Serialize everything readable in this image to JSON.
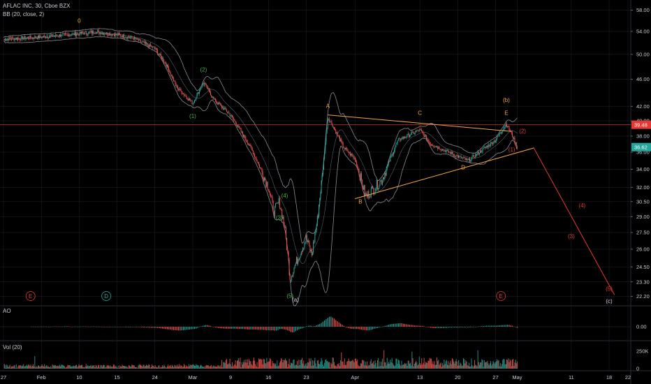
{
  "header": {
    "symbol_line": "AFLAC INC, 30, Cboe BZX",
    "indicator_line": "BB (20, close, 2)"
  },
  "panes": {
    "ao_label": "AO",
    "volume_label": "Vol (20)"
  },
  "colors": {
    "background": "#000000",
    "grid": "#1c1e24",
    "candle_up": "#26a69a",
    "candle_down": "#ef5350",
    "bollinger": "#8a8d95",
    "trendline": "#f7a54a",
    "projection": "#e53935",
    "price_line": "#c0392b",
    "wave_orange": "#f7a54a",
    "wave_green": "#4caf50",
    "wave_red": "#e53935"
  },
  "chart_data": {
    "type": "candlestick",
    "price_axis": {
      "ticks": [
        "58.00",
        "54.00",
        "50.00",
        "46.00",
        "42.00",
        "40.00",
        "38.00",
        "36.00",
        "34.00",
        "32.00",
        "30.50",
        "29.00",
        "27.50",
        "26.00",
        "24.50",
        "23.30",
        "22.20"
      ],
      "ylim": [
        21.5,
        60
      ],
      "scale": "log"
    },
    "time_axis": {
      "ticks": [
        "27",
        "Feb",
        "10",
        "15",
        "24",
        "Mar",
        "9",
        "16",
        "23",
        "Apr",
        "13",
        "20",
        "27",
        "May",
        "11",
        "18",
        "22"
      ]
    },
    "price_tags": [
      {
        "value": "39.48",
        "role": "horizontal-level",
        "color": "#e53935"
      },
      {
        "value": "36.62",
        "role": "last-price",
        "color": "#26a69a"
      }
    ],
    "path": [
      {
        "date": "2020-01-27",
        "price": 52.6
      },
      {
        "date": "2020-02-03",
        "price": 53.0
      },
      {
        "date": "2020-02-10",
        "price": 53.6
      },
      {
        "date": "2020-02-13",
        "price": 53.9
      },
      {
        "date": "2020-02-17",
        "price": 53.4
      },
      {
        "date": "2020-02-20",
        "price": 52.8
      },
      {
        "date": "2020-02-24",
        "price": 51.0
      },
      {
        "date": "2020-02-26",
        "price": 48.5
      },
      {
        "date": "2020-02-28",
        "price": 44.8
      },
      {
        "date": "2020-03-02",
        "price": 42.4
      },
      {
        "date": "2020-03-04",
        "price": 45.5
      },
      {
        "date": "2020-03-06",
        "price": 42.9
      },
      {
        "date": "2020-03-09",
        "price": 40.8
      },
      {
        "date": "2020-03-11",
        "price": 38.5
      },
      {
        "date": "2020-03-13",
        "price": 36.2
      },
      {
        "date": "2020-03-16",
        "price": 32.0
      },
      {
        "date": "2020-03-17",
        "price": 29.5
      },
      {
        "date": "2020-03-18",
        "price": 30.5
      },
      {
        "date": "2020-03-19",
        "price": 28.0
      },
      {
        "date": "2020-03-20",
        "price": 23.6
      },
      {
        "date": "2020-03-23",
        "price": 27.0
      },
      {
        "date": "2020-03-24",
        "price": 25.5
      },
      {
        "date": "2020-03-25",
        "price": 28.5
      },
      {
        "date": "2020-03-26",
        "price": 33.5
      },
      {
        "date": "2020-03-27",
        "price": 40.5
      },
      {
        "date": "2020-03-30",
        "price": 36.5
      },
      {
        "date": "2020-04-01",
        "price": 35.2
      },
      {
        "date": "2020-04-03",
        "price": 31.0
      },
      {
        "date": "2020-04-06",
        "price": 32.8
      },
      {
        "date": "2020-04-09",
        "price": 37.5
      },
      {
        "date": "2020-04-13",
        "price": 38.8
      },
      {
        "date": "2020-04-15",
        "price": 37.0
      },
      {
        "date": "2020-04-20",
        "price": 35.5
      },
      {
        "date": "2020-04-22",
        "price": 35.0
      },
      {
        "date": "2020-04-27",
        "price": 37.5
      },
      {
        "date": "2020-04-29",
        "price": 39.6
      },
      {
        "date": "2020-04-30",
        "price": 38.2
      },
      {
        "date": "2020-05-01",
        "price": 36.6
      }
    ],
    "projection": [
      {
        "date": "2020-05-04",
        "price": 36.6
      },
      {
        "date": "2020-05-19",
        "price": 22.3
      }
    ],
    "trendlines": [
      {
        "from": {
          "date": "2020-03-27",
          "price": 40.8
        },
        "to": {
          "date": "2020-04-30",
          "price": 38.6
        }
      },
      {
        "from": {
          "date": "2020-04-01",
          "price": 30.8
        },
        "to": {
          "date": "2020-05-04",
          "price": 36.5
        }
      }
    ],
    "horizontal_level": 39.48,
    "wave_labels": [
      {
        "text": "0",
        "date": "2020-02-10",
        "price": 55.6,
        "color": "#f7a54a"
      },
      {
        "text": "(2)",
        "date": "2020-03-04",
        "price": 47.2,
        "color": "#4caf50"
      },
      {
        "text": "(1)",
        "date": "2020-03-02",
        "price": 40.4,
        "color": "#4caf50"
      },
      {
        "text": "(4)",
        "date": "2020-03-19",
        "price": 30.9,
        "color": "#4caf50"
      },
      {
        "text": "(3)",
        "date": "2020-03-18",
        "price": 28.7,
        "color": "#4caf50"
      },
      {
        "text": "(5)",
        "date": "2020-03-20",
        "price": 22.1,
        "color": "#4caf50"
      },
      {
        "text": "(a)",
        "date": "2020-03-21",
        "price": 21.8,
        "color": "#d1d4dc"
      },
      {
        "text": "A",
        "date": "2020-03-27",
        "price": 41.8,
        "color": "#f7a54a"
      },
      {
        "text": "B",
        "date": "2020-04-02",
        "price": 30.3,
        "color": "#f7a54a"
      },
      {
        "text": "C",
        "date": "2020-04-13",
        "price": 40.8,
        "color": "#f7a54a"
      },
      {
        "text": "D",
        "date": "2020-04-21",
        "price": 34.0,
        "color": "#f7a54a"
      },
      {
        "text": "E",
        "date": "2020-04-29",
        "price": 40.8,
        "color": "#f7a54a"
      },
      {
        "text": "(b)",
        "date": "2020-04-29",
        "price": 42.6,
        "color": "#f7a54a"
      },
      {
        "text": "(2)",
        "date": "2020-05-02",
        "price": 38.4,
        "color": "#e53935"
      },
      {
        "text": "(1)",
        "date": "2020-04-30",
        "price": 36.1,
        "color": "#e53935"
      },
      {
        "text": "(4)",
        "date": "2020-05-13",
        "price": 29.9,
        "color": "#e53935"
      },
      {
        "text": "(3)",
        "date": "2020-05-11",
        "price": 27.0,
        "color": "#e53935"
      },
      {
        "text": "(5)",
        "date": "2020-05-18",
        "price": 22.6,
        "color": "#e53935"
      },
      {
        "text": "(c)",
        "date": "2020-05-18",
        "price": 21.7,
        "color": "#d1d4dc"
      }
    ],
    "event_markers": [
      {
        "text": "E",
        "date": "2020-02-01",
        "color": "#e53935"
      },
      {
        "text": "D",
        "date": "2020-02-15",
        "color": "#26a69a"
      },
      {
        "text": "E",
        "date": "2020-04-28",
        "color": "#e53935"
      }
    ],
    "ao": {
      "zero_label": "0.00"
    },
    "volume": {
      "ticks": [
        "250K",
        "0"
      ]
    }
  }
}
